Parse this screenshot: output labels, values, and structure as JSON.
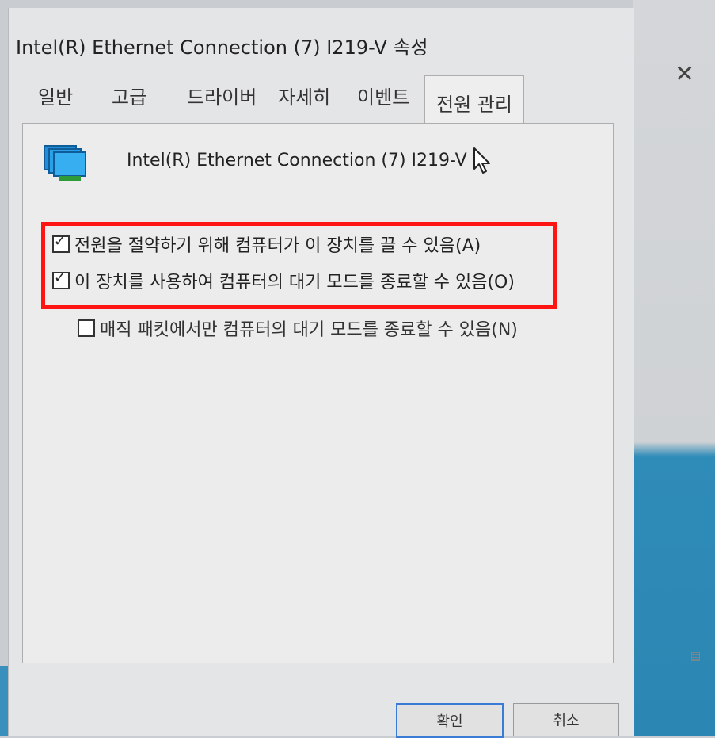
{
  "window": {
    "title": "Intel(R) Ethernet Connection (7) I219-V 속성",
    "close_glyph": "✕"
  },
  "tabs": [
    {
      "label": "일반"
    },
    {
      "label": "고급"
    },
    {
      "label": "드라이버"
    },
    {
      "label": "자세히"
    },
    {
      "label": "이벤트"
    },
    {
      "label": "전원 관리",
      "active": true
    }
  ],
  "device": {
    "icon": "network-adapter-icon",
    "name": "Intel(R) Ethernet Connection (7) I219-V"
  },
  "options": [
    {
      "label": "전원을 절약하기 위해 컴퓨터가 이 장치를 끌 수 있음(A)",
      "checked": true
    },
    {
      "label": "이 장치를 사용하여 컴퓨터의 대기 모드를 종료할 수 있음(O)",
      "checked": true
    },
    {
      "label": "매직 패킷에서만 컴퓨터의 대기 모드를 종료할 수 있음(N)",
      "checked": false
    }
  ],
  "buttons": {
    "ok": "확인",
    "cancel": "취소"
  },
  "colors": {
    "highlight_box": "#ff1414",
    "accent": "#3a7bd5"
  }
}
